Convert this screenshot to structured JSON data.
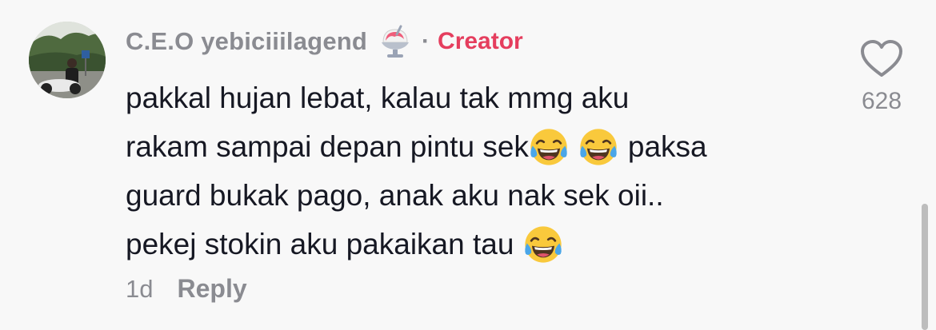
{
  "comment": {
    "username": "C.E.O yebiciiilagend",
    "name_emoji": "shaved-ice-icon",
    "separator": "·",
    "badge": "Creator",
    "text_lines": [
      "pakkal hujan lebat, kalau tak mmg aku",
      "rakam sampai depan pintu sek",
      "paksa",
      "guard bukak pago, anak aku nak sek oii..",
      "pekej stokin aku pakaikan tau"
    ],
    "emojis": [
      "face-with-tears-of-joy-icon",
      "face-with-tears-of-joy-icon",
      "face-with-tears-of-joy-icon"
    ],
    "time": "1d",
    "reply_label": "Reply",
    "likes": "628"
  },
  "colors": {
    "background": "#f8f8f8",
    "text": "#161823",
    "muted": "#8a8b91",
    "creator": "#e53e5e"
  }
}
